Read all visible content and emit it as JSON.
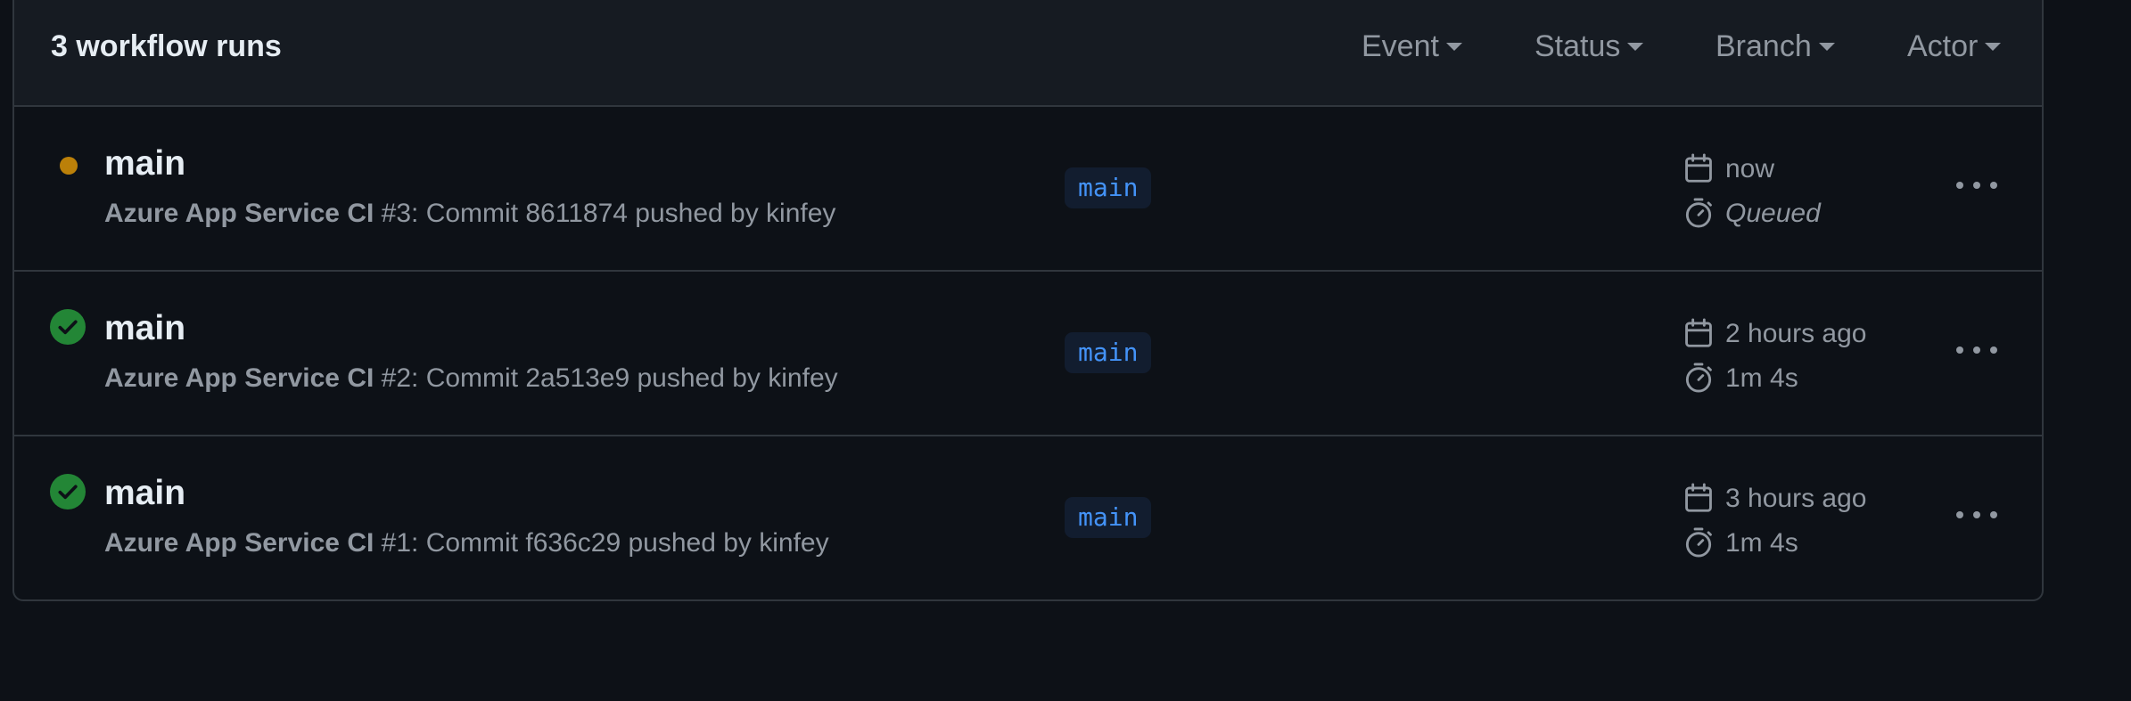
{
  "header": {
    "run_count_label": "3 workflow runs",
    "filters": {
      "event": "Event",
      "status": "Status",
      "branch": "Branch",
      "actor": "Actor"
    }
  },
  "runs": [
    {
      "status": "queued",
      "status_icon": "queued-dot-icon",
      "title": "main",
      "workflow": "Azure App Service CI",
      "description": " #3: Commit 8611874 pushed by kinfey",
      "branch": "main",
      "started": "now",
      "duration": "Queued"
    },
    {
      "status": "success",
      "status_icon": "check-circle-icon",
      "title": "main",
      "workflow": "Azure App Service CI",
      "description": " #2: Commit 2a513e9 pushed by kinfey",
      "branch": "main",
      "started": "2 hours ago",
      "duration": "1m 4s"
    },
    {
      "status": "success",
      "status_icon": "check-circle-icon",
      "title": "main",
      "workflow": "Azure App Service CI",
      "description": " #1: Commit f636c29 pushed by kinfey",
      "branch": "main",
      "started": "3 hours ago",
      "duration": "1m 4s"
    }
  ],
  "colors": {
    "background": "#0d1117",
    "header_bg": "#161b22",
    "border": "#30363d",
    "text_primary": "#e6edf3",
    "text_muted": "#9198a1",
    "queued": "#bb8009",
    "success": "#238636",
    "branch_text": "#4493f8",
    "branch_bg": "#121d2f"
  }
}
